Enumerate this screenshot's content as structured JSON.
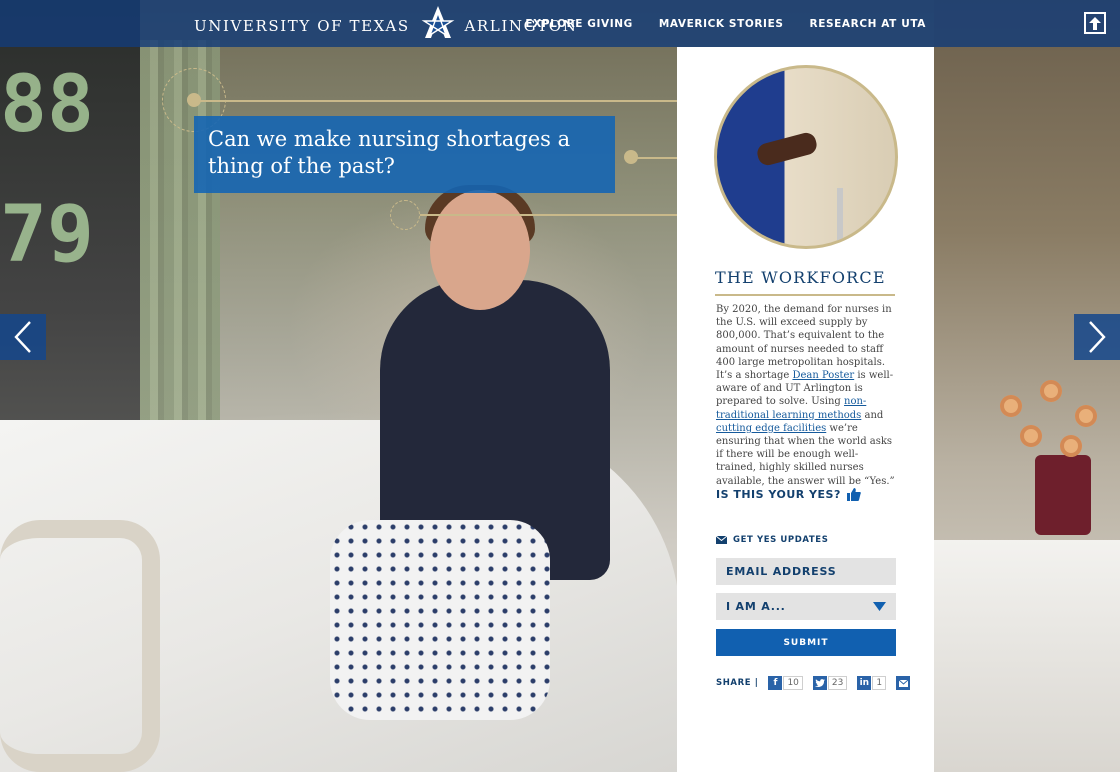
{
  "header": {
    "logo_left": "UNIVERSITY OF TEXAS",
    "logo_right": "ARLINGTON",
    "nav": [
      "EXPLORE GIVING",
      "MAVERICK STORIES",
      "RESEARCH AT UTA"
    ]
  },
  "background": {
    "monitor_numbers": [
      "88",
      "79"
    ]
  },
  "hero": {
    "question": "Can we make nursing shortages a thing of the past?"
  },
  "panel": {
    "title": "THE WORKFORCE",
    "body_1": "By 2020, the demand for nurses in the U.S. will exceed supply by 800,000. That’s equivalent to the amount of nurses needed to staff 400 large metropolitan hospitals. It’s a shortage ",
    "link_dean": "Dean Poster",
    "body_2": " is well- aware of and UT Arlington is prepared to solve. Using ",
    "link_methods": "non-traditional learning methods",
    "body_3": " and ",
    "link_facilities": "cutting edge facilities",
    "body_4": " we’re ensuring that when the world asks if there will be enough well-trained, highly skilled nurses available, the answer will be “Yes.”",
    "yes_question": "IS THIS YOUR YES?",
    "updates_label": "GET YES UPDATES",
    "email_placeholder": "EMAIL ADDRESS",
    "select_label": "I AM A...",
    "submit_label": "SUBMIT",
    "share_label": "SHARE |",
    "share": {
      "facebook_count": "10",
      "twitter_count": "23",
      "linkedin_count": "1"
    }
  },
  "colors": {
    "brand_blue": "#1160b0",
    "navy": "#13406e",
    "gold": "#c9b98a"
  }
}
